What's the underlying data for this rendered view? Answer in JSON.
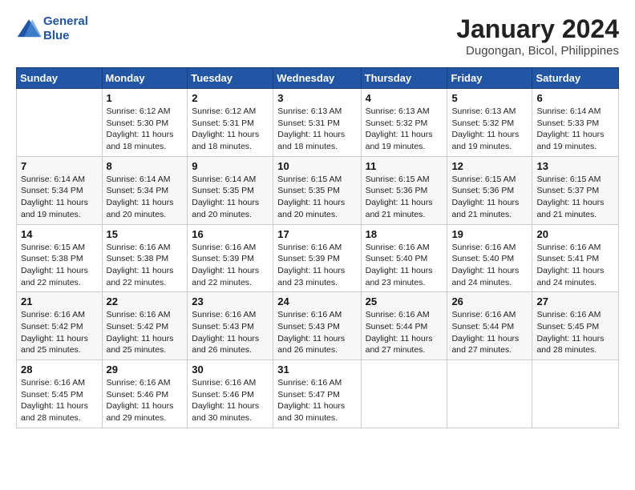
{
  "logo": {
    "text_general": "General",
    "text_blue": "Blue"
  },
  "title": "January 2024",
  "subtitle": "Dugongan, Bicol, Philippines",
  "header_days": [
    "Sunday",
    "Monday",
    "Tuesday",
    "Wednesday",
    "Thursday",
    "Friday",
    "Saturday"
  ],
  "weeks": [
    [
      {
        "day": "",
        "info": ""
      },
      {
        "day": "1",
        "info": "Sunrise: 6:12 AM\nSunset: 5:30 PM\nDaylight: 11 hours\nand 18 minutes."
      },
      {
        "day": "2",
        "info": "Sunrise: 6:12 AM\nSunset: 5:31 PM\nDaylight: 11 hours\nand 18 minutes."
      },
      {
        "day": "3",
        "info": "Sunrise: 6:13 AM\nSunset: 5:31 PM\nDaylight: 11 hours\nand 18 minutes."
      },
      {
        "day": "4",
        "info": "Sunrise: 6:13 AM\nSunset: 5:32 PM\nDaylight: 11 hours\nand 19 minutes."
      },
      {
        "day": "5",
        "info": "Sunrise: 6:13 AM\nSunset: 5:32 PM\nDaylight: 11 hours\nand 19 minutes."
      },
      {
        "day": "6",
        "info": "Sunrise: 6:14 AM\nSunset: 5:33 PM\nDaylight: 11 hours\nand 19 minutes."
      }
    ],
    [
      {
        "day": "7",
        "info": "Sunrise: 6:14 AM\nSunset: 5:34 PM\nDaylight: 11 hours\nand 19 minutes."
      },
      {
        "day": "8",
        "info": "Sunrise: 6:14 AM\nSunset: 5:34 PM\nDaylight: 11 hours\nand 20 minutes."
      },
      {
        "day": "9",
        "info": "Sunrise: 6:14 AM\nSunset: 5:35 PM\nDaylight: 11 hours\nand 20 minutes."
      },
      {
        "day": "10",
        "info": "Sunrise: 6:15 AM\nSunset: 5:35 PM\nDaylight: 11 hours\nand 20 minutes."
      },
      {
        "day": "11",
        "info": "Sunrise: 6:15 AM\nSunset: 5:36 PM\nDaylight: 11 hours\nand 21 minutes."
      },
      {
        "day": "12",
        "info": "Sunrise: 6:15 AM\nSunset: 5:36 PM\nDaylight: 11 hours\nand 21 minutes."
      },
      {
        "day": "13",
        "info": "Sunrise: 6:15 AM\nSunset: 5:37 PM\nDaylight: 11 hours\nand 21 minutes."
      }
    ],
    [
      {
        "day": "14",
        "info": "Sunrise: 6:15 AM\nSunset: 5:38 PM\nDaylight: 11 hours\nand 22 minutes."
      },
      {
        "day": "15",
        "info": "Sunrise: 6:16 AM\nSunset: 5:38 PM\nDaylight: 11 hours\nand 22 minutes."
      },
      {
        "day": "16",
        "info": "Sunrise: 6:16 AM\nSunset: 5:39 PM\nDaylight: 11 hours\nand 22 minutes."
      },
      {
        "day": "17",
        "info": "Sunrise: 6:16 AM\nSunset: 5:39 PM\nDaylight: 11 hours\nand 23 minutes."
      },
      {
        "day": "18",
        "info": "Sunrise: 6:16 AM\nSunset: 5:40 PM\nDaylight: 11 hours\nand 23 minutes."
      },
      {
        "day": "19",
        "info": "Sunrise: 6:16 AM\nSunset: 5:40 PM\nDaylight: 11 hours\nand 24 minutes."
      },
      {
        "day": "20",
        "info": "Sunrise: 6:16 AM\nSunset: 5:41 PM\nDaylight: 11 hours\nand 24 minutes."
      }
    ],
    [
      {
        "day": "21",
        "info": "Sunrise: 6:16 AM\nSunset: 5:42 PM\nDaylight: 11 hours\nand 25 minutes."
      },
      {
        "day": "22",
        "info": "Sunrise: 6:16 AM\nSunset: 5:42 PM\nDaylight: 11 hours\nand 25 minutes."
      },
      {
        "day": "23",
        "info": "Sunrise: 6:16 AM\nSunset: 5:43 PM\nDaylight: 11 hours\nand 26 minutes."
      },
      {
        "day": "24",
        "info": "Sunrise: 6:16 AM\nSunset: 5:43 PM\nDaylight: 11 hours\nand 26 minutes."
      },
      {
        "day": "25",
        "info": "Sunrise: 6:16 AM\nSunset: 5:44 PM\nDaylight: 11 hours\nand 27 minutes."
      },
      {
        "day": "26",
        "info": "Sunrise: 6:16 AM\nSunset: 5:44 PM\nDaylight: 11 hours\nand 27 minutes."
      },
      {
        "day": "27",
        "info": "Sunrise: 6:16 AM\nSunset: 5:45 PM\nDaylight: 11 hours\nand 28 minutes."
      }
    ],
    [
      {
        "day": "28",
        "info": "Sunrise: 6:16 AM\nSunset: 5:45 PM\nDaylight: 11 hours\nand 28 minutes."
      },
      {
        "day": "29",
        "info": "Sunrise: 6:16 AM\nSunset: 5:46 PM\nDaylight: 11 hours\nand 29 minutes."
      },
      {
        "day": "30",
        "info": "Sunrise: 6:16 AM\nSunset: 5:46 PM\nDaylight: 11 hours\nand 30 minutes."
      },
      {
        "day": "31",
        "info": "Sunrise: 6:16 AM\nSunset: 5:47 PM\nDaylight: 11 hours\nand 30 minutes."
      },
      {
        "day": "",
        "info": ""
      },
      {
        "day": "",
        "info": ""
      },
      {
        "day": "",
        "info": ""
      }
    ]
  ]
}
